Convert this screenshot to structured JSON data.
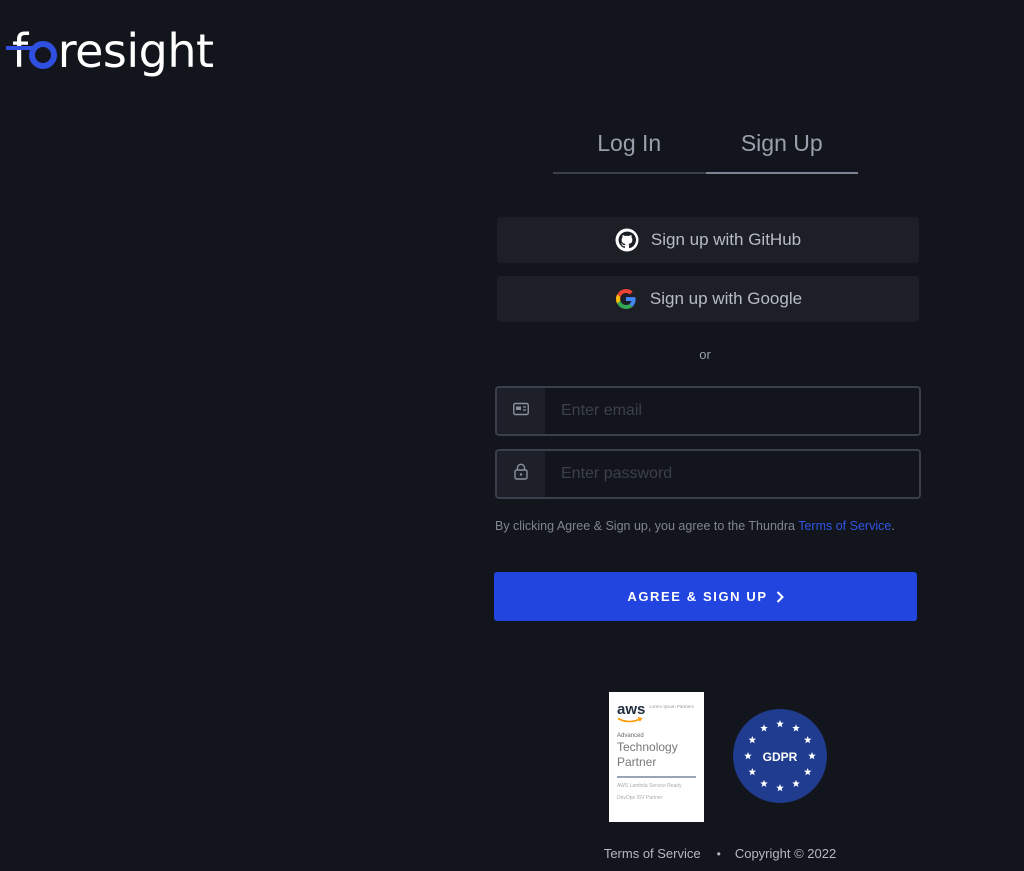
{
  "brand": {
    "logo_text": "foresight",
    "accent": "#2f4fe0"
  },
  "tabs": [
    {
      "label": "Log In"
    },
    {
      "label": "Sign Up",
      "active": true
    }
  ],
  "oauth": {
    "github_label": "Sign up with GitHub",
    "github_icon": "github-icon",
    "google_label": "Sign up with Google",
    "google_icon": "google-icon"
  },
  "separator": "or",
  "form": {
    "email_placeholder": "Enter email",
    "email_icon": "id-card-icon",
    "password_placeholder": "Enter password",
    "password_icon": "lock-icon",
    "terms_prefix": "By clicking Agree & Sign up, you agree to the Thundra ",
    "terms_link": "Terms of Service",
    "terms_suffix": ".",
    "submit_label": "AGREE & SIGN UP",
    "submit_color": "#2245e0"
  },
  "badges": {
    "aws": {
      "logo": "aws",
      "small_text": "Lorem Ipsum Partners",
      "tier": "Advanced",
      "title_line1": "Technology",
      "title_line2": "Partner",
      "desc": "AWS Lambda Service Ready",
      "desc2": "DevOps ISV Partner"
    },
    "gdpr": {
      "label": "GDPR",
      "color": "#1f3c8f"
    }
  },
  "footer": {
    "terms_link": "Terms of Service",
    "copyright": "Copyright © 2022"
  }
}
